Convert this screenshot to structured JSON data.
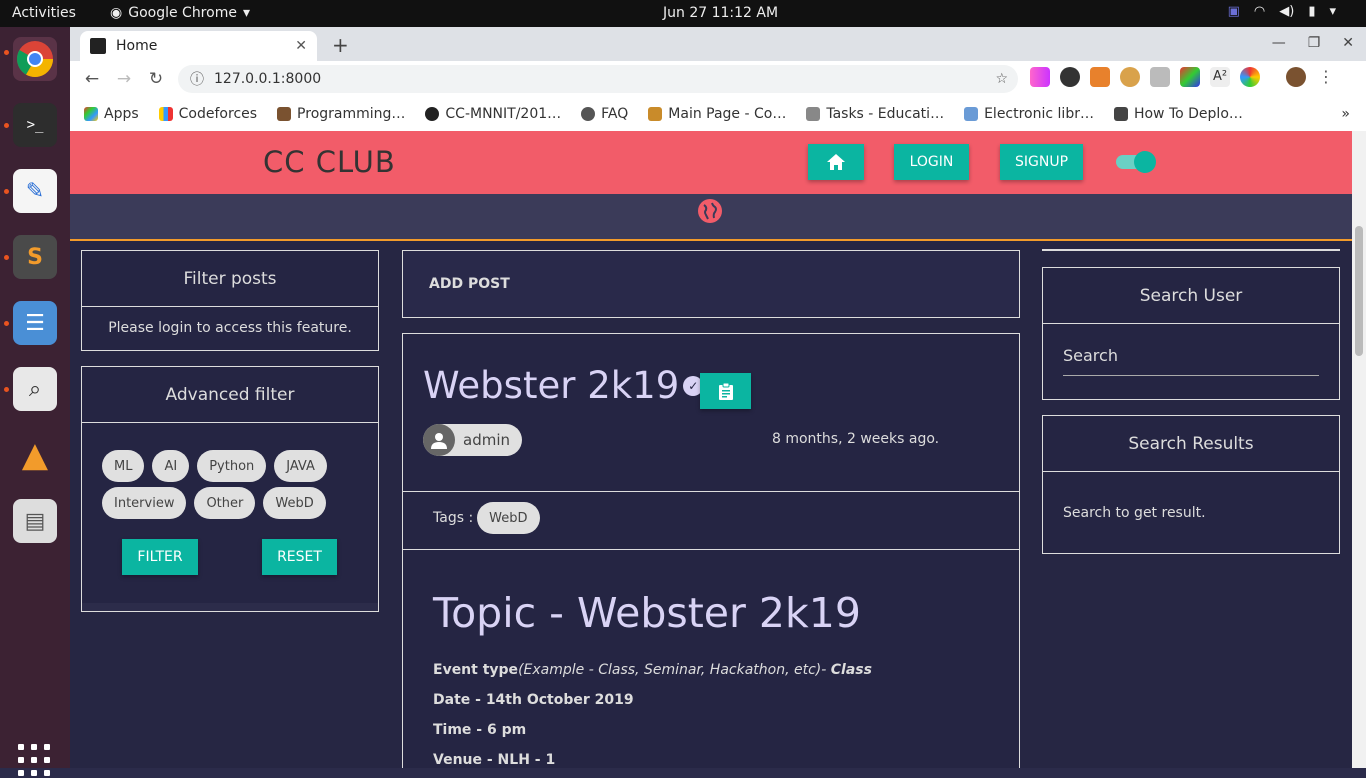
{
  "os": {
    "activities": "Activities",
    "app_name": "Google Chrome",
    "clock": "Jun 27  11:12 AM"
  },
  "browser": {
    "tab_title": "Home",
    "url": "127.0.0.1:8000",
    "bookmarks": [
      "Apps",
      "Codeforces",
      "Programming…",
      "CC-MNNIT/201…",
      "FAQ",
      "Main Page - Co…",
      "Tasks - Educati…",
      "Electronic libr…",
      "How To Deplo…"
    ]
  },
  "site": {
    "brand": "CC CLUB",
    "login_label": "LOGIN",
    "signup_label": "SIGNUP"
  },
  "filter_posts": {
    "title": "Filter posts",
    "message": "Please login to access this feature."
  },
  "advanced_filter": {
    "title": "Advanced filter",
    "tags": [
      "ML",
      "AI",
      "Python",
      "JAVA",
      "Interview",
      "Other",
      "WebD"
    ],
    "filter_label": "FILTER",
    "reset_label": "RESET"
  },
  "add_post": {
    "label": "ADD POST"
  },
  "post": {
    "title": "Webster 2k19",
    "author": "admin",
    "time": "8 months, 2 weeks ago.",
    "tags_label": "Tags :",
    "tag": "WebD",
    "topic": "Topic - Webster 2k19",
    "event_type_label": "Event type",
    "event_type_hint": "(Example - Class, Seminar, Hackathon, etc)- ",
    "event_type_value": "Class",
    "date": "Date - 14th October 2019",
    "time_line": "Time - 6 pm",
    "venue": "Venue - NLH - 1"
  },
  "search_user": {
    "title": "Search User",
    "placeholder": "Search"
  },
  "search_results": {
    "title": "Search Results",
    "message": "Search to get result."
  },
  "colors": {
    "header": "#f25c69",
    "accent": "#0bb5a1",
    "background": "#262643"
  }
}
